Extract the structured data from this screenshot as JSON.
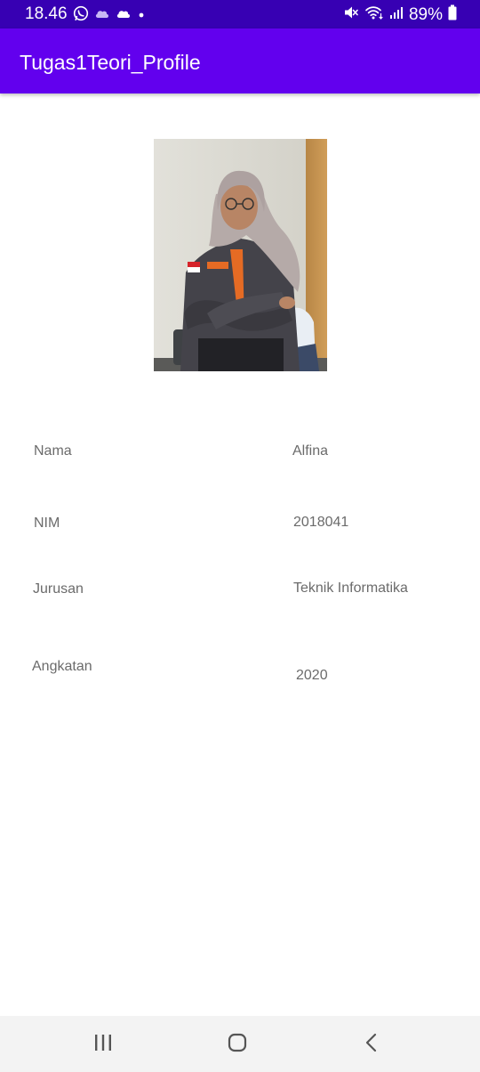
{
  "status_bar": {
    "time": "18.46",
    "battery_percent": "89%",
    "left_icons": [
      "whatsapp-icon",
      "cloud-icon",
      "cloud-icon",
      "dot-icon"
    ],
    "right_icons": [
      "mute-icon",
      "wifi-icon",
      "signal-icon",
      "battery-icon"
    ]
  },
  "app_bar": {
    "title": "Tugas1Teori_Profile"
  },
  "profile": {
    "fields": [
      {
        "label": "Nama",
        "value": "Alfina"
      },
      {
        "label": "NIM",
        "value": "2018041"
      },
      {
        "label": "Jurusan",
        "value": "Teknik Informatika"
      },
      {
        "label": "Angkatan",
        "value": "2020"
      }
    ]
  },
  "nav_bar": {
    "buttons": [
      "recents-icon",
      "home-icon",
      "back-icon"
    ]
  },
  "colors": {
    "status_bar": "#3700b3",
    "app_bar": "#6200ee",
    "text_secondary": "#6b6b6b",
    "nav_bar": "#f3f3f3"
  }
}
